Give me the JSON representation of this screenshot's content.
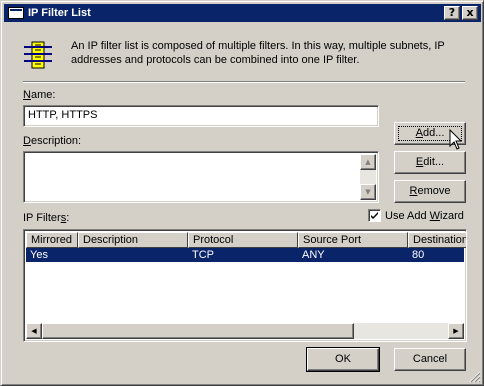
{
  "window": {
    "title": "IP Filter List",
    "help_glyph": "?",
    "close_glyph": "x"
  },
  "intro": {
    "text": "An IP filter list is composed of multiple filters. In this way, multiple subnets, IP addresses and protocols can be combined into one IP filter."
  },
  "name": {
    "label_prefix": "",
    "label_mnemonic": "N",
    "label_rest": "ame:",
    "value": "HTTP, HTTPS"
  },
  "description": {
    "label_prefix": "",
    "label_mnemonic": "D",
    "label_rest": "escription:",
    "value": ""
  },
  "buttons": {
    "add": {
      "prefix": "",
      "mnemonic": "A",
      "rest": "dd..."
    },
    "edit": {
      "prefix": "",
      "mnemonic": "E",
      "rest": "dit..."
    },
    "remove": {
      "prefix": "",
      "mnemonic": "R",
      "rest": "emove"
    },
    "ok": "OK",
    "cancel": "Cancel"
  },
  "wizard": {
    "checked": true,
    "label_prefix": "Use Add ",
    "label_mnemonic": "W",
    "label_rest": "izard"
  },
  "filters": {
    "label_prefix": "IP Filter",
    "label_mnemonic": "s",
    "label_rest": ":",
    "columns": [
      "Mirrored",
      "Description",
      "Protocol",
      "Source Port",
      "Destination"
    ],
    "rows": [
      [
        "Yes",
        "",
        "TCP",
        "ANY",
        "80"
      ]
    ]
  },
  "colors": {
    "titlebar": "#0a246a",
    "face": "#d4d0c8",
    "selection": "#0a246a"
  }
}
